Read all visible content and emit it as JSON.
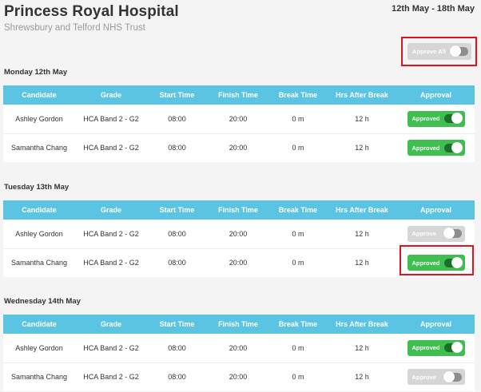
{
  "header": {
    "title": "Princess Royal Hospital",
    "subtitle": "Shrewsbury and Telford NHS Trust",
    "date_range": "12th May - 18th May"
  },
  "approve_all": {
    "label": "Approve All",
    "state": "off"
  },
  "columns": [
    "Candidate",
    "Grade",
    "Start Time",
    "Finish Time",
    "Break Time",
    "Hrs After Break",
    "Approval"
  ],
  "colors": {
    "header_bg": "#5bc4e2",
    "approved_green": "#3ebf4f",
    "off_gray": "#d6d6d6",
    "highlight_red": "#e8101c"
  },
  "days": [
    {
      "heading": "Monday 12th May",
      "rows": [
        {
          "candidate": "Ashley Gordon",
          "grade": "HCA Band 2 - G2",
          "start": "08:00",
          "finish": "20:00",
          "break": "0 m",
          "hrs": "12 h",
          "approval_label": "Approved",
          "approval_state": "on"
        },
        {
          "candidate": "Samantha Chang",
          "grade": "HCA Band 2 - G2",
          "start": "08:00",
          "finish": "20:00",
          "break": "0 m",
          "hrs": "12 h",
          "approval_label": "Approved",
          "approval_state": "on"
        }
      ]
    },
    {
      "heading": "Tuesday 13th May",
      "rows": [
        {
          "candidate": "Ashley Gordon",
          "grade": "HCA Band 2 - G2",
          "start": "08:00",
          "finish": "20:00",
          "break": "0 m",
          "hrs": "12 h",
          "approval_label": "Approve",
          "approval_state": "off"
        },
        {
          "candidate": "Samantha Chang",
          "grade": "HCA Band 2 - G2",
          "start": "08:00",
          "finish": "20:00",
          "break": "0 m",
          "hrs": "12 h",
          "approval_label": "Approved",
          "approval_state": "on"
        }
      ]
    },
    {
      "heading": "Wednesday 14th May",
      "rows": [
        {
          "candidate": "Ashley Gordon",
          "grade": "HCA Band 2 - G2",
          "start": "08:00",
          "finish": "20:00",
          "break": "0 m",
          "hrs": "12 h",
          "approval_label": "Approved",
          "approval_state": "on"
        },
        {
          "candidate": "Samantha Chang",
          "grade": "HCA Band 2 - G2",
          "start": "08:00",
          "finish": "20:00",
          "break": "0 m",
          "hrs": "12 h",
          "approval_label": "Approve",
          "approval_state": "off"
        }
      ]
    }
  ]
}
